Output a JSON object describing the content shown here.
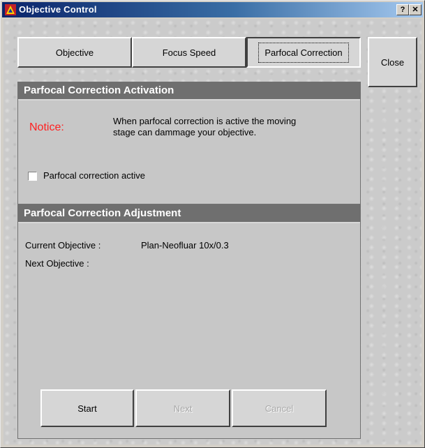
{
  "window": {
    "title": "Objective Control",
    "help_label": "?",
    "close_label": "✕"
  },
  "tabs": [
    {
      "label": "Objective"
    },
    {
      "label": "Focus Speed"
    },
    {
      "label": "Parfocal Correction",
      "selected": true
    }
  ],
  "close_button_label": "Close",
  "activation_panel": {
    "title": "Parfocal Correction Activation",
    "notice_label": "Notice:",
    "notice_text_line1": "When parfocal correction is active the moving",
    "notice_text_line2": "stage can dammage your objective.",
    "checkbox_label": "Parfocal correction active",
    "checkbox_checked": false
  },
  "adjustment_panel": {
    "title": "Parfocal Correction Adjustment",
    "current_objective_label": "Current Objective :",
    "current_objective_value": "Plan-Neofluar 10x/0.3",
    "next_objective_label": "Next Objective :",
    "next_objective_value": ""
  },
  "actions": {
    "start_label": "Start",
    "next_label": "Next",
    "cancel_label": "Cancel"
  }
}
